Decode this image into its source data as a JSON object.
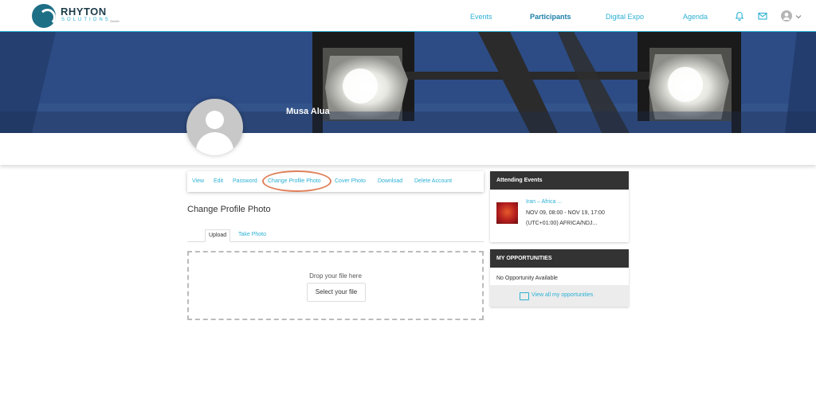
{
  "brand": {
    "name": "RHYTON",
    "sub": "SOLUTIONS",
    "suffix": "GmbH"
  },
  "nav": {
    "events": "Events",
    "participants": "Participants",
    "digital_expo": "Digital Expo",
    "agenda": "Agenda"
  },
  "header_icons": [
    "bell-icon",
    "mail-icon",
    "user-avatar-icon",
    "chevron-down-icon"
  ],
  "profile": {
    "name": "Musa Alua"
  },
  "profile_tabs": [
    "View",
    "Edit",
    "Password",
    "Change Profile Photo",
    "Cover Photo",
    "Download",
    "Delete Account"
  ],
  "active_tab": "Change Profile Photo",
  "page_title": "Change Profile Photo",
  "upload_tabs": {
    "upload": "Upload",
    "take_photo": "Take Photo"
  },
  "dropzone": {
    "text": "Drop your file here",
    "button": "Select your file"
  },
  "attending": {
    "heading": "Attending Events",
    "event": {
      "title": "Iran – Africa ...",
      "dates": "NOV 09, 08:00 - NOV 19, 17:00",
      "location": "(UTC+01:00) AFRICA/NDJ..."
    }
  },
  "opportunities": {
    "heading": "MY OPPORTUNITIES",
    "empty": "No Opportunity Available",
    "link": "View all my opportunities"
  },
  "colors": {
    "accent": "#2bb0d4",
    "dark_panel": "#333333",
    "highlight_ring": "#e0805a",
    "cover": "#2c4e86"
  }
}
